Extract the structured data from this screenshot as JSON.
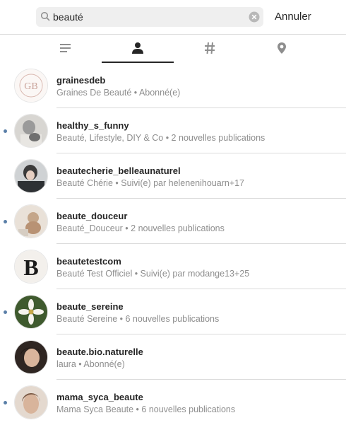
{
  "search": {
    "value": "beauté",
    "cancel_label": "Annuler"
  },
  "tabs": [
    {
      "icon": "top-results-icon",
      "active": false
    },
    {
      "icon": "accounts-icon",
      "active": true
    },
    {
      "icon": "hashtag-icon",
      "active": false
    },
    {
      "icon": "places-icon",
      "active": false
    }
  ],
  "results": [
    {
      "username": "grainesdeb",
      "subtitle": "Graines De Beauté • Abonné(e)",
      "new": false,
      "avatar": "graines-logo"
    },
    {
      "username": "healthy_s_funny",
      "subtitle": "Beauté, Lifestyle, DIY & Co • 2 nouvelles publications",
      "new": true,
      "avatar": "photo"
    },
    {
      "username": "beautecherie_belleaunaturel",
      "subtitle": "Beauté Chérie • Suivi(e) par helenenihouarn+17",
      "new": false,
      "avatar": "photo"
    },
    {
      "username": "beaute_douceur",
      "subtitle": "Beauté_Douceur • 2 nouvelles publications",
      "new": true,
      "avatar": "photo"
    },
    {
      "username": "beautetestcom",
      "subtitle": "Beauté Test Officiel • Suivi(e) par modange13+25",
      "new": false,
      "avatar": "letter-b-logo"
    },
    {
      "username": "beaute_sereine",
      "subtitle": "Beauté Sereine • 6 nouvelles publications",
      "new": true,
      "avatar": "flower-photo"
    },
    {
      "username": "beaute.bio.naturelle",
      "subtitle": "laura • Abonné(e)",
      "new": false,
      "avatar": "photo"
    },
    {
      "username": "mama_syca_beaute",
      "subtitle": "Mama Syca Beaute • 6 nouvelles publications",
      "new": true,
      "avatar": "photo"
    }
  ],
  "colors": {
    "text": "#262626",
    "muted": "#8e8e8e",
    "new_dot": "#5a7fa8",
    "search_bg": "#efefef"
  }
}
